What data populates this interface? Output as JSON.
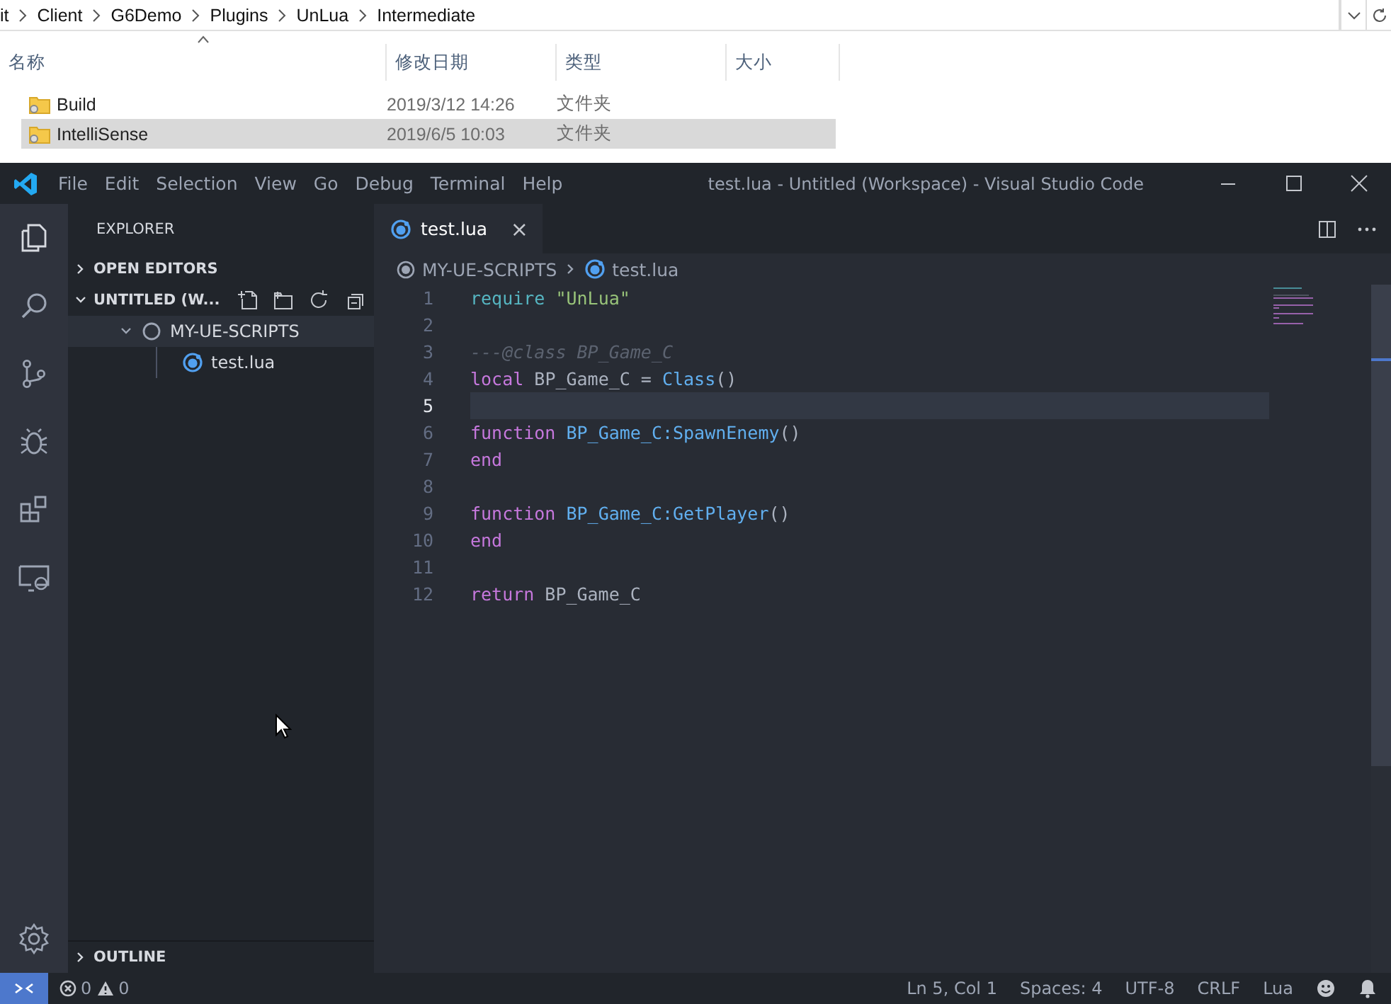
{
  "file_explorer": {
    "breadcrumb": [
      "it",
      "Client",
      "G6Demo",
      "Plugins",
      "UnLua",
      "Intermediate"
    ],
    "columns": [
      "名称",
      "修改日期",
      "类型",
      "大小"
    ],
    "rows": [
      {
        "name": "Build",
        "modified": "2019/3/12 14:26",
        "type": "文件夹",
        "selected": false
      },
      {
        "name": "IntelliSense",
        "modified": "2019/6/5 10:03",
        "type": "文件夹",
        "selected": true
      }
    ]
  },
  "vscode": {
    "menu": [
      "File",
      "Edit",
      "Selection",
      "View",
      "Go",
      "Debug",
      "Terminal",
      "Help"
    ],
    "title": "test.lua - Untitled (Workspace) - Visual Studio Code",
    "sidebar": {
      "title": "EXPLORER",
      "sections": [
        {
          "label": "OPEN EDITORS",
          "expanded": false
        },
        {
          "label": "UNTITLED (W...",
          "expanded": true,
          "tree": [
            {
              "label": "MY-UE-SCRIPTS",
              "kind": "folder",
              "expanded": true,
              "selected": true,
              "children": [
                {
                  "label": "test.lua",
                  "kind": "file",
                  "selected": false
                }
              ]
            }
          ]
        },
        {
          "label": "OUTLINE",
          "expanded": false
        }
      ]
    },
    "tabs": [
      {
        "label": "test.lua",
        "selected": true,
        "close": "×"
      }
    ],
    "breadcrumb": [
      "MY-UE-SCRIPTS",
      "test.lua"
    ],
    "code": [
      {
        "number": "1",
        "current": false,
        "tokens": [
          {
            "kind": "builtin",
            "text": "require"
          },
          {
            "kind": "string",
            "text": " \"UnLua\""
          }
        ]
      },
      {
        "number": "2",
        "current": false
      },
      {
        "number": "3",
        "current": false,
        "tokens": [
          {
            "kind": "comment",
            "text": "---@class BP_Game_C"
          }
        ]
      },
      {
        "number": "4",
        "current": false,
        "tokens": [
          {
            "kind": "keyword",
            "text": "local"
          },
          {
            "kind": "plain",
            "text": " BP_Game_C = "
          },
          {
            "kind": "function",
            "text": "Class"
          },
          {
            "kind": "plain",
            "text": "()"
          }
        ]
      },
      {
        "number": "5",
        "current": true
      },
      {
        "number": "6",
        "current": false,
        "tokens": [
          {
            "kind": "keyword",
            "text": "function"
          },
          {
            "kind": "function",
            "text": " BP_Game_C:SpawnEnemy"
          },
          {
            "kind": "plain",
            "text": "()"
          }
        ]
      },
      {
        "number": "7",
        "current": false,
        "tokens": [
          {
            "kind": "keyword",
            "text": "end"
          }
        ]
      },
      {
        "number": "8",
        "current": false
      },
      {
        "number": "9",
        "current": false,
        "tokens": [
          {
            "kind": "keyword",
            "text": "function"
          },
          {
            "kind": "function",
            "text": " BP_Game_C:GetPlayer"
          },
          {
            "kind": "plain",
            "text": "()"
          }
        ]
      },
      {
        "number": "10",
        "current": false,
        "tokens": [
          {
            "kind": "keyword",
            "text": "end"
          }
        ]
      },
      {
        "number": "11",
        "current": false
      },
      {
        "number": "12",
        "current": false,
        "tokens": [
          {
            "kind": "keyword",
            "text": "return"
          },
          {
            "kind": "plain",
            "text": " BP_Game_C"
          }
        ]
      }
    ],
    "status_bar": {
      "errors": "0",
      "warnings": "0",
      "items": [
        "Ln 5, Col 1",
        "Spaces: 4",
        "UTF-8",
        "CRLF",
        "Lua"
      ]
    }
  }
}
